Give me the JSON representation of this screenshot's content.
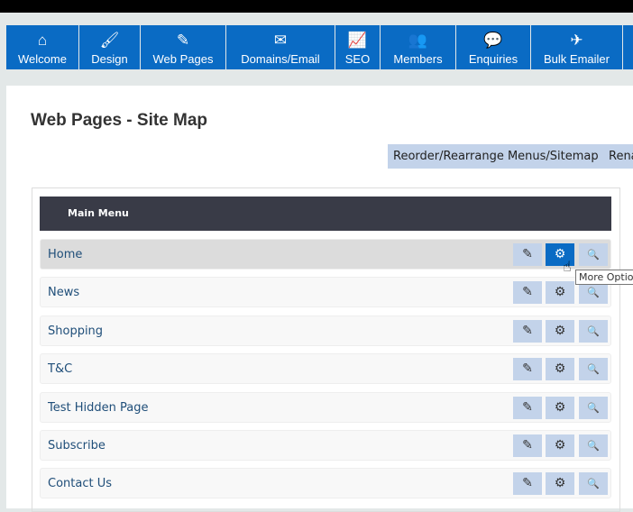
{
  "nav": [
    {
      "label": "Welcome",
      "icon": "home-icon",
      "g": "⌂"
    },
    {
      "label": "Design",
      "icon": "brush-icon",
      "g": "🖌"
    },
    {
      "label": "Web Pages",
      "icon": "edit-icon",
      "g": "✎"
    },
    {
      "label": "Domains/Email",
      "icon": "envelope-icon",
      "g": "✉"
    },
    {
      "label": "SEO",
      "icon": "chart-line-icon",
      "g": "📈"
    },
    {
      "label": "Members",
      "icon": "users-icon",
      "g": "👥"
    },
    {
      "label": "Enquiries",
      "icon": "comments-icon",
      "g": "💬"
    },
    {
      "label": "Bulk Emailer",
      "icon": "paper-plane-icon",
      "g": "✈"
    },
    {
      "label": "",
      "icon": "more-icon",
      "g": ""
    }
  ],
  "page_title": "Web Pages - Site Map",
  "toolbar": {
    "reorder": "Reorder/Rearrange Menus/Sitemap",
    "rename": "Rename"
  },
  "menu": {
    "title": "Main Menu",
    "rows": [
      "Home",
      "News",
      "Shopping",
      "T&C",
      "Test Hidden Page",
      "Subscribe",
      "Contact Us"
    ]
  },
  "tooltip": "More Options",
  "icons": {
    "edit": "✎",
    "gear": "⚙",
    "search": "🔍"
  }
}
